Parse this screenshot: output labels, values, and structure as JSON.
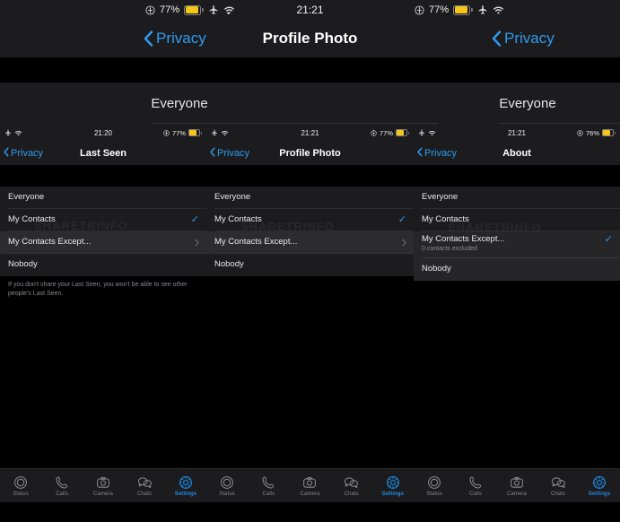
{
  "outer": {
    "status": {
      "battery_pct": "77%",
      "time": "21:21",
      "icons": [
        "location-icon",
        "battery-icon",
        "airplane-icon",
        "wifi-icon"
      ]
    },
    "nav": {
      "back_label_left": "Privacy",
      "back_label_right": "Privacy",
      "title": "Profile Photo"
    },
    "value_left": "Everyone",
    "value_right": "Everyone"
  },
  "colors": {
    "accent": "#2e9bf0",
    "tab_active": "#1e8ae6",
    "battery": "#f5c518",
    "row_bg": "#1c1c1e",
    "row_highlight": "#2c2c2e",
    "screen_bg": "#000000",
    "label": "#e9e9ea",
    "subtle": "#8e8e93"
  },
  "watermark": "SHARETRINFO",
  "panels": [
    {
      "status": {
        "time": "21:20",
        "battery_pct": "77%"
      },
      "nav": {
        "back_label": "Privacy",
        "title": "Last Seen"
      },
      "rows": [
        {
          "label": "Everyone",
          "selected": false,
          "chevron": false,
          "highlight": false,
          "sub": ""
        },
        {
          "label": "My Contacts",
          "selected": true,
          "chevron": false,
          "highlight": false,
          "sub": ""
        },
        {
          "label": "My Contacts Except...",
          "selected": false,
          "chevron": true,
          "highlight": true,
          "sub": ""
        },
        {
          "label": "Nobody",
          "selected": false,
          "chevron": false,
          "highlight": false,
          "sub": ""
        }
      ],
      "footer": "If you don't share your Last Seen, you won't be able to see other people's Last Seen."
    },
    {
      "status": {
        "time": "21:21",
        "battery_pct": "77%"
      },
      "nav": {
        "back_label": "Privacy",
        "title": "Profile Photo"
      },
      "rows": [
        {
          "label": "Everyone",
          "selected": false,
          "chevron": false,
          "highlight": false,
          "sub": ""
        },
        {
          "label": "My Contacts",
          "selected": true,
          "chevron": false,
          "highlight": false,
          "sub": ""
        },
        {
          "label": "My Contacts Except...",
          "selected": false,
          "chevron": true,
          "highlight": true,
          "sub": ""
        },
        {
          "label": "Nobody",
          "selected": false,
          "chevron": false,
          "highlight": false,
          "sub": ""
        }
      ],
      "footer": ""
    },
    {
      "status": {
        "time": "21:21",
        "battery_pct": "76%"
      },
      "nav": {
        "back_label": "Privacy",
        "title": "About"
      },
      "rows": [
        {
          "label": "Everyone",
          "selected": false,
          "chevron": false,
          "highlight": false,
          "sub": ""
        },
        {
          "label": "My Contacts",
          "selected": false,
          "chevron": false,
          "highlight": false,
          "sub": ""
        },
        {
          "label": "My Contacts Except...",
          "selected": true,
          "chevron": false,
          "highlight": true,
          "sub": "0 contacts excluded"
        },
        {
          "label": "Nobody",
          "selected": false,
          "chevron": false,
          "highlight": true,
          "sub": ""
        }
      ],
      "footer": ""
    }
  ],
  "tabs": [
    {
      "label": "Status",
      "icon": "status-icon",
      "active": false
    },
    {
      "label": "Calls",
      "icon": "calls-icon",
      "active": false
    },
    {
      "label": "Camera",
      "icon": "camera-icon",
      "active": false
    },
    {
      "label": "Chats",
      "icon": "chats-icon",
      "active": false
    },
    {
      "label": "Settings",
      "icon": "settings-icon",
      "active": true
    }
  ]
}
